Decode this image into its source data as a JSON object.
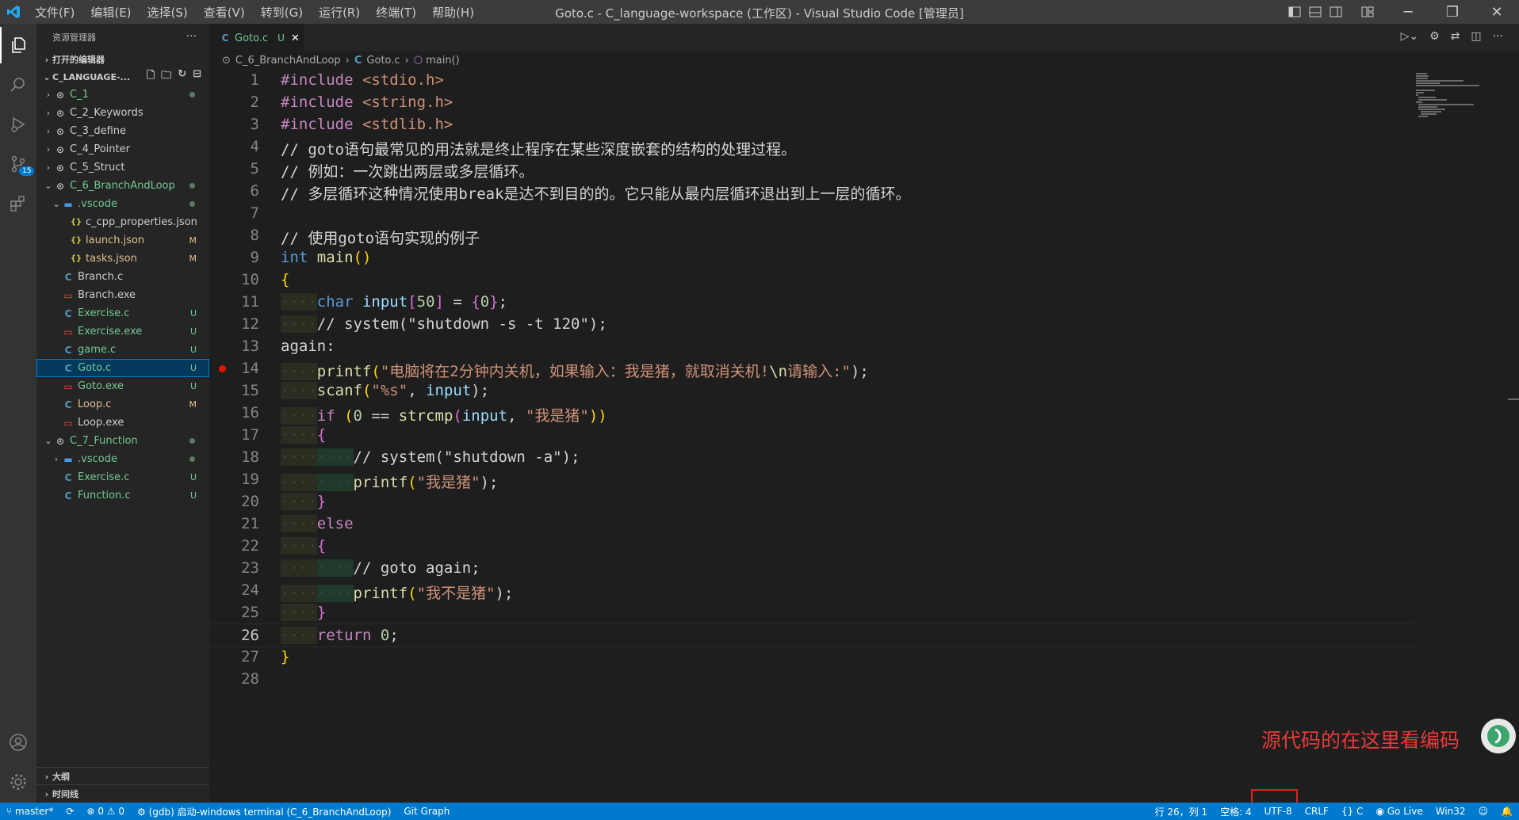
{
  "titlebar": {
    "menu": [
      "文件(F)",
      "编辑(E)",
      "选择(S)",
      "查看(V)",
      "转到(G)",
      "运行(R)",
      "终端(T)",
      "帮助(H)"
    ],
    "title": "Goto.c - C_language-workspace (工作区) - Visual Studio Code [管理员]"
  },
  "sidebar": {
    "header": "资源管理器",
    "open_editors": "打开的编辑器",
    "workspace": "C_LANGUAGE-...",
    "outline": "大纲",
    "timeline": "时间线",
    "activity_badge": "15",
    "items": [
      {
        "label": "C_1",
        "indent": 0,
        "kind": "folder-root",
        "open": false,
        "status": "dot"
      },
      {
        "label": "C_2_Keywords",
        "indent": 0,
        "kind": "folder-root",
        "open": false,
        "status": ""
      },
      {
        "label": "C_3_define",
        "indent": 0,
        "kind": "folder-root",
        "open": false,
        "status": ""
      },
      {
        "label": "C_4_Pointer",
        "indent": 0,
        "kind": "folder-root",
        "open": false,
        "status": ""
      },
      {
        "label": "C_5_Struct",
        "indent": 0,
        "kind": "folder-root",
        "open": false,
        "status": ""
      },
      {
        "label": "C_6_BranchAndLoop",
        "indent": 0,
        "kind": "folder-root",
        "open": true,
        "status": "dot"
      },
      {
        "label": ".vscode",
        "indent": 1,
        "kind": "folder",
        "open": true,
        "status": "dot"
      },
      {
        "label": "c_cpp_properties.json",
        "indent": 2,
        "kind": "json",
        "status": ""
      },
      {
        "label": "launch.json",
        "indent": 2,
        "kind": "json",
        "status": "M"
      },
      {
        "label": "tasks.json",
        "indent": 2,
        "kind": "json",
        "status": "M"
      },
      {
        "label": "Branch.c",
        "indent": 1,
        "kind": "c",
        "status": ""
      },
      {
        "label": "Branch.exe",
        "indent": 1,
        "kind": "exe",
        "status": ""
      },
      {
        "label": "Exercise.c",
        "indent": 1,
        "kind": "c",
        "status": "U"
      },
      {
        "label": "Exercise.exe",
        "indent": 1,
        "kind": "exe",
        "status": "U"
      },
      {
        "label": "game.c",
        "indent": 1,
        "kind": "c",
        "status": "U"
      },
      {
        "label": "Goto.c",
        "indent": 1,
        "kind": "c",
        "status": "U",
        "selected": true
      },
      {
        "label": "Goto.exe",
        "indent": 1,
        "kind": "exe",
        "status": "U"
      },
      {
        "label": "Loop.c",
        "indent": 1,
        "kind": "c",
        "status": "M"
      },
      {
        "label": "Loop.exe",
        "indent": 1,
        "kind": "exe",
        "status": ""
      },
      {
        "label": "C_7_Function",
        "indent": 0,
        "kind": "folder-root",
        "open": true,
        "status": "dot"
      },
      {
        "label": ".vscode",
        "indent": 1,
        "kind": "folder",
        "open": false,
        "status": "dot"
      },
      {
        "label": "Exercise.c",
        "indent": 1,
        "kind": "c",
        "status": "U"
      },
      {
        "label": "Function.c",
        "indent": 1,
        "kind": "c",
        "status": "U"
      }
    ]
  },
  "editor": {
    "tab_label": "Goto.c",
    "tab_status": "U",
    "breadcrumb": [
      "C_6_BranchAndLoop",
      "Goto.c",
      "main()"
    ],
    "breakpoint_line": 14,
    "lines": [
      "1",
      "2",
      "3",
      "4",
      "5",
      "6",
      "7",
      "8",
      "9",
      "10",
      "11",
      "12",
      "13",
      "14",
      "15",
      "16",
      "17",
      "18",
      "19",
      "20",
      "21",
      "22",
      "23",
      "24",
      "25",
      "26",
      "27",
      "28"
    ],
    "code": {
      "l1a": "#include ",
      "l1b": "<stdio.h>",
      "l2a": "#include ",
      "l2b": "<string.h>",
      "l3a": "#include ",
      "l3b": "<stdlib.h>",
      "l4": "// goto语句最常见的用法就是终止程序在某些深度嵌套的结构的处理过程。",
      "l5": "// 例如：一次跳出两层或多层循环。",
      "l6": "// 多层循环这种情况使用break是达不到目的的。它只能从最内层循环退出到上一层的循环。",
      "l8": "// 使用goto语句实现的例子",
      "l9a": "int",
      "l9b": "main",
      "l9c": "()",
      "l10": "{",
      "l11a": "char",
      "l11b": "input",
      "l11c": "[",
      "l11d": "50",
      "l11e": "]",
      "l11f": " = ",
      "l11g": "{",
      "l11h": "0",
      "l11i": "}",
      "l11j": ";",
      "l12": "// system(\"shutdown -s -t 120\");",
      "l13": "again:",
      "l14a": "printf",
      "l14b": "(",
      "l14c": "\"电脑将在2分钟内关机，如果输入：我是猪，就取消关机!",
      "l14d": "\\n",
      "l14e": "请输入:\"",
      "l14f": ");",
      "l15a": "scanf",
      "l15b": "(",
      "l15c": "\"%s\"",
      "l15d": ", ",
      "l15e": "input",
      "l15f": ");",
      "l16a": "if",
      "l16b": " (",
      "l16c": "0",
      "l16d": " == ",
      "l16e": "strcmp",
      "l16f": "(",
      "l16g": "input",
      "l16h": ", ",
      "l16i": "\"我是猪\"",
      "l16j": "))",
      "l17": "{",
      "l18": "// system(\"shutdown -a\");",
      "l19a": "printf",
      "l19b": "(",
      "l19c": "\"我是猪\"",
      "l19d": ");",
      "l20": "}",
      "l21": "else",
      "l22": "{",
      "l23": "// goto again;",
      "l24a": "printf",
      "l24b": "(",
      "l24c": "\"我不是猪\"",
      "l24d": ");",
      "l25": "}",
      "l26a": "return",
      "l26b": "0",
      "l26c": ";",
      "l27": "}"
    }
  },
  "annotation": "源代码的在这里看编码",
  "statusbar": {
    "branch": "master*",
    "errors": "0",
    "warnings": "0",
    "debug": "(gdb) 启动-windows terminal (C_6_BranchAndLoop)",
    "git_graph": "Git Graph",
    "position": "行 26，列 1",
    "spaces": "空格: 4",
    "encoding": "UTF-8",
    "eol": "CRLF",
    "language": "C",
    "golive": "Go Live",
    "platform": "Win32"
  },
  "colors": {
    "accent": "#007acc",
    "selection": "#04395e",
    "untracked": "#73c991",
    "modified": "#e2c08d",
    "annotation": "#e83a3a"
  }
}
